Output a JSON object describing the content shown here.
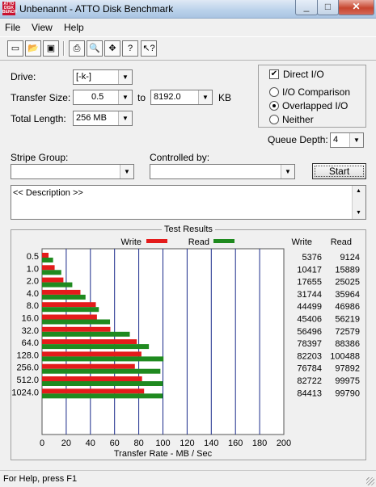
{
  "window": {
    "title": "Unbenannt - ATTO Disk Benchmark",
    "app_icon_text": "ATTO DISK BENCH"
  },
  "menu": [
    "File",
    "View",
    "Help"
  ],
  "toolbar": [
    "new-icon",
    "open-icon",
    "save-icon",
    "print-icon",
    "print-preview-icon",
    "move-icon",
    "help-icon",
    "context-help-icon"
  ],
  "form": {
    "drive_label": "Drive:",
    "drive_value": "[-k-]",
    "transfer_label": "Transfer Size:",
    "transfer_from": "0.5",
    "to_label": "to",
    "transfer_to": "8192.0",
    "kb_label": "KB",
    "length_label": "Total Length:",
    "length_value": "256 MB",
    "direct_io": "Direct I/O",
    "io_comparison": "I/O Comparison",
    "overlapped_io": "Overlapped I/O",
    "neither": "Neither",
    "queue_label": "Queue Depth:",
    "queue_value": "4",
    "stripe_label": "Stripe Group:",
    "controlled_label": "Controlled by:",
    "start_label": "Start",
    "description": "<< Description >>"
  },
  "results": {
    "title": "Test Results",
    "write_label": "Write",
    "read_label": "Read",
    "col_write": "Write",
    "col_read": "Read",
    "write_color": "#e41b1b",
    "read_color": "#1f8a1f"
  },
  "chart_data": {
    "type": "bar",
    "orientation": "horizontal",
    "categories": [
      "0.5",
      "1.0",
      "2.0",
      "4.0",
      "8.0",
      "16.0",
      "32.0",
      "64.0",
      "128.0",
      "256.0",
      "512.0",
      "1024.0"
    ],
    "series": [
      {
        "name": "Write",
        "values": [
          5376,
          10417,
          17655,
          31744,
          44499,
          45406,
          56496,
          78397,
          82203,
          76784,
          82722,
          84413
        ]
      },
      {
        "name": "Read",
        "values": [
          9124,
          15889,
          25025,
          35964,
          46986,
          56219,
          72579,
          88386,
          100488,
          97892,
          99975,
          99790
        ]
      }
    ],
    "xlabel": "Transfer Rate - MB / Sec",
    "xticks": [
      "0",
      "20",
      "40",
      "60",
      "80",
      "100",
      "120",
      "140",
      "160",
      "180",
      "200"
    ],
    "xlim": [
      0,
      200
    ],
    "grid": true
  },
  "status": "For Help, press F1"
}
